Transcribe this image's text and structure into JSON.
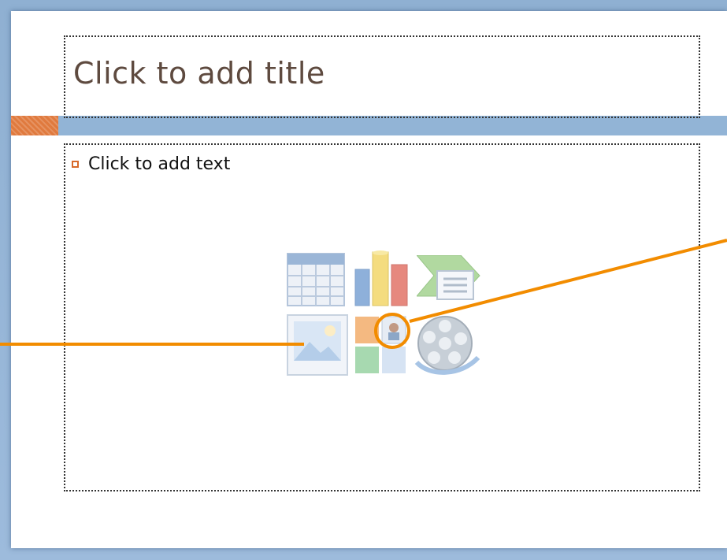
{
  "slide": {
    "title_placeholder": "Click to add title",
    "content_placeholder": "Click to add text"
  },
  "content_icons": [
    {
      "name": "insert-table-icon"
    },
    {
      "name": "insert-chart-icon"
    },
    {
      "name": "insert-smartart-icon"
    },
    {
      "name": "insert-picture-icon"
    },
    {
      "name": "insert-clip-art-icon"
    },
    {
      "name": "insert-media-clip-icon"
    }
  ],
  "colors": {
    "frame": "#9dbbdc",
    "accent_bar": "#92b4d6",
    "accent_orange": "#e07a3e",
    "title_text": "#5e4a3f",
    "callout": "#f28c00"
  }
}
